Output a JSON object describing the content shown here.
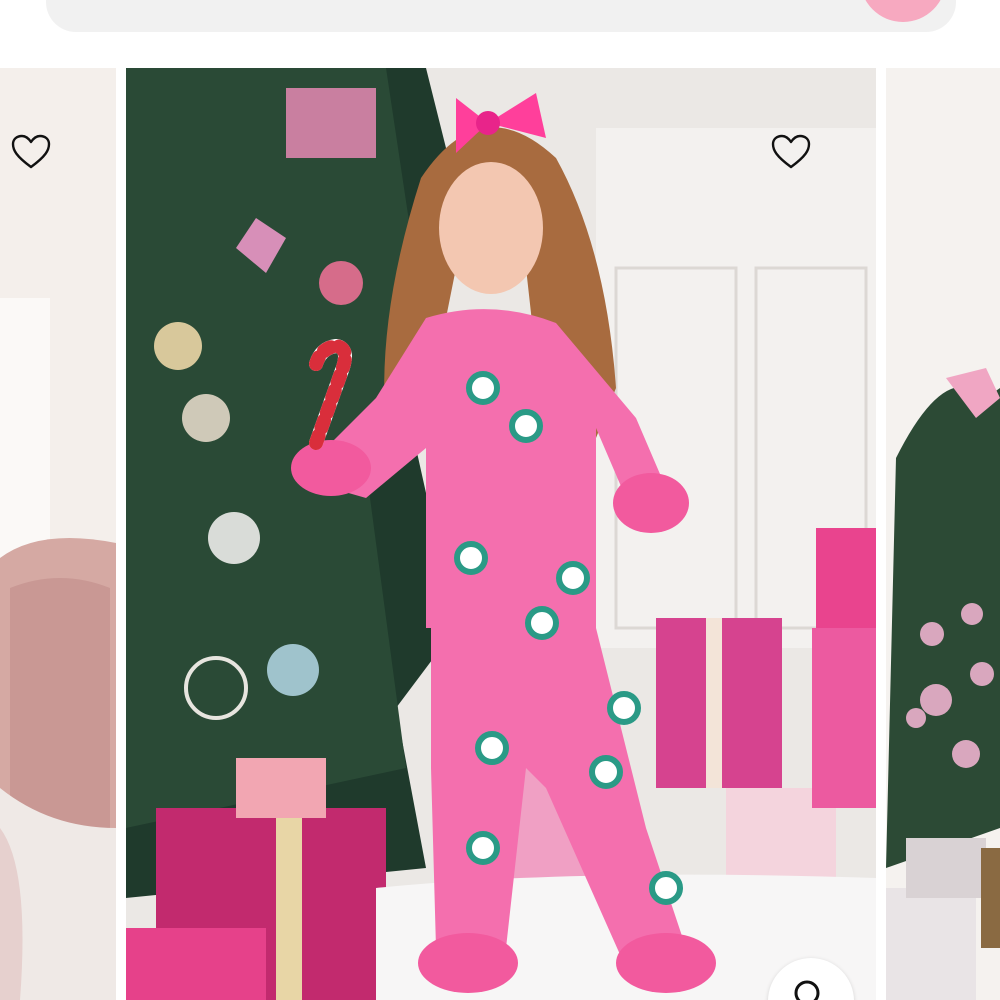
{
  "search": {
    "placeholder": ""
  },
  "carousel": {
    "cards": [
      {
        "id": "left",
        "favorite_icon": "heart-outline-icon"
      },
      {
        "id": "main",
        "favorite_icon": "heart-outline-icon",
        "zoom_icon": "search-icon"
      },
      {
        "id": "right"
      }
    ]
  },
  "colors": {
    "accent": "#f7a9c0",
    "pajama_pink": "#f46fae",
    "bow_pink": "#ff3f9b"
  }
}
